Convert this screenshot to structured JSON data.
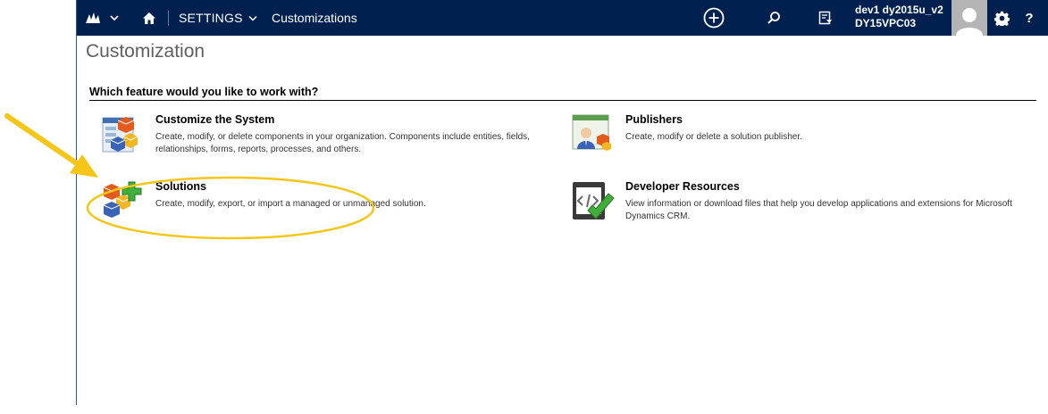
{
  "nav": {
    "logo_icon": "dynamics-logo-icon",
    "home_icon": "home-icon",
    "settings_label": "SETTINGS",
    "settings_chevron": "⌄",
    "current_area": "Customizations",
    "user_name": "dev1 dy2015u_v2",
    "org_name": "DY15VPC03",
    "help_label": "?"
  },
  "page": {
    "title": "Customization",
    "section_heading": "Which feature would you like to work with?"
  },
  "features": {
    "customize": {
      "title": "Customize the System",
      "description": "Create, modify, or delete components in your organization. Components include entities, fields, relationships, forms, reports, processes, and others."
    },
    "solutions": {
      "title": "Solutions",
      "description": "Create, modify, export, or import a managed or unmanaged solution."
    },
    "publishers": {
      "title": "Publishers",
      "description": "Create, modify or delete a solution publisher."
    },
    "developer_resources": {
      "title": "Developer Resources",
      "description": "View information or download files that help you develop applications and extensions for Microsoft Dynamics CRM."
    }
  },
  "colors": {
    "navbar": "#002050",
    "annotation": "#f5c518"
  }
}
